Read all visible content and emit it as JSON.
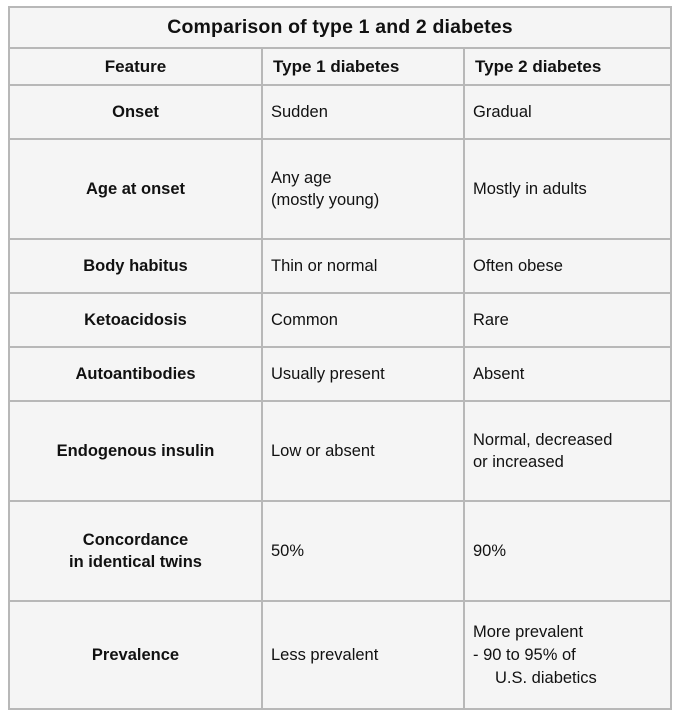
{
  "table": {
    "title": "Comparison of type 1 and 2 diabetes",
    "columns": [
      "Feature",
      "Type 1 diabetes",
      "Type 2 diabetes"
    ],
    "rows": [
      {
        "feature": [
          "Onset"
        ],
        "type1": [
          "Sudden"
        ],
        "type2": [
          "Gradual"
        ]
      },
      {
        "feature": [
          "Age at onset"
        ],
        "type1": [
          "Any age",
          "(mostly young)"
        ],
        "type2": [
          "Mostly in adults"
        ]
      },
      {
        "feature": [
          "Body habitus"
        ],
        "type1": [
          "Thin or normal"
        ],
        "type2": [
          "Often obese"
        ]
      },
      {
        "feature": [
          "Ketoacidosis"
        ],
        "type1": [
          "Common"
        ],
        "type2": [
          "Rare"
        ]
      },
      {
        "feature": [
          "Autoantibodies"
        ],
        "type1": [
          "Usually present"
        ],
        "type2": [
          "Absent"
        ]
      },
      {
        "feature": [
          "Endogenous insulin"
        ],
        "type1": [
          "Low or absent"
        ],
        "type2": [
          "Normal, decreased",
          "or increased"
        ]
      },
      {
        "feature": [
          "Concordance",
          "in identical twins"
        ],
        "type1": [
          "50%"
        ],
        "type2": [
          "90%"
        ]
      },
      {
        "feature": [
          "Prevalence"
        ],
        "type1": [
          "Less prevalent"
        ],
        "type2": [
          "More prevalent",
          "- 90 to 95% of",
          "U.S. diabetics"
        ]
      }
    ]
  },
  "colors": {
    "border": "#b8b8b8",
    "cell_background": "#f5f5f5",
    "text": "#111111",
    "page_background": "#ffffff"
  }
}
